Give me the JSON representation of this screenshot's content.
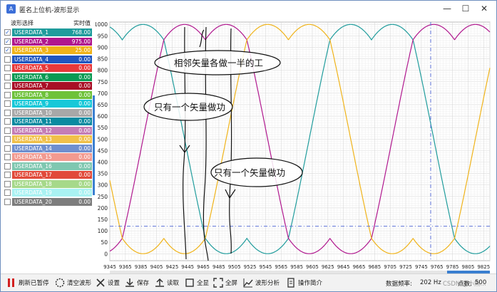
{
  "window": {
    "title": "匿名上位机-波形显示",
    "minimize": "—",
    "maximize": "☐",
    "close": "✕"
  },
  "left_panel": {
    "header_select": "波形选择",
    "header_value": "实时值",
    "channels": [
      {
        "name": "USERDATA_1",
        "value": "768.00",
        "checked": true,
        "color": "#1f9c9c"
      },
      {
        "name": "USERDATA_2",
        "value": "975.00",
        "checked": true,
        "color": "#b0178e"
      },
      {
        "name": "USERDATA_3",
        "value": "25.00",
        "checked": true,
        "color": "#f0b319"
      },
      {
        "name": "USERDATA_4",
        "value": "0.00",
        "checked": false,
        "color": "#1f56c0"
      },
      {
        "name": "USERDATA_5",
        "value": "0.00",
        "checked": false,
        "color": "#e8393b"
      },
      {
        "name": "USERDATA_6",
        "value": "0.00",
        "checked": false,
        "color": "#0a9a53"
      },
      {
        "name": "USERDATA_7",
        "value": "0.00",
        "checked": false,
        "color": "#a80f26"
      },
      {
        "name": "USERDATA_8",
        "value": "0.00",
        "checked": false,
        "color": "#6ec23a"
      },
      {
        "name": "USERDATA_9",
        "value": "0.00",
        "checked": false,
        "color": "#17c8d8"
      },
      {
        "name": "USERDATA_10",
        "value": "0.00",
        "checked": false,
        "color": "#a8a8a8"
      },
      {
        "name": "USERDATA_11",
        "value": "0.00",
        "checked": false,
        "color": "#0a8aa0"
      },
      {
        "name": "USERDATA_12",
        "value": "0.00",
        "checked": false,
        "color": "#c47db6"
      },
      {
        "name": "USERDATA_13",
        "value": "0.00",
        "checked": false,
        "color": "#f1c04a"
      },
      {
        "name": "USERDATA_14",
        "value": "0.00",
        "checked": false,
        "color": "#6f8fcf"
      },
      {
        "name": "USERDATA_15",
        "value": "0.00",
        "checked": false,
        "color": "#f29a90"
      },
      {
        "name": "USERDATA_16",
        "value": "0.00",
        "checked": false,
        "color": "#7fc7b0"
      },
      {
        "name": "USERDATA_17",
        "value": "0.00",
        "checked": false,
        "color": "#e14a3a"
      },
      {
        "name": "USERDATA_18",
        "value": "0.00",
        "checked": false,
        "color": "#a6d98a"
      },
      {
        "name": "USERDATA_19",
        "value": "0.00",
        "checked": false,
        "color": "#a9f2f2"
      },
      {
        "name": "USERDATA_20",
        "value": "0.00",
        "checked": false,
        "color": "#7d7d7d"
      }
    ]
  },
  "annotations": {
    "a1": "相邻矢量各做一半的工",
    "a2": "只有一个矢量做功",
    "a3": "只有一个矢量做功"
  },
  "chart_data": {
    "type": "line",
    "y_ticks": [
      "1000",
      "950",
      "900",
      "850",
      "800",
      "750",
      "700",
      "650",
      "600",
      "550",
      "500",
      "450",
      "400",
      "350",
      "300",
      "250",
      "200",
      "150",
      "100",
      "50",
      "0"
    ],
    "x_ticks": [
      "9345",
      "9365",
      "9385",
      "9405",
      "9425",
      "9445",
      "9465",
      "9485",
      "9505",
      "9525",
      "9545",
      "9565",
      "9585",
      "9605",
      "9625",
      "9645",
      "9665",
      "9685",
      "9705",
      "9725",
      "9745",
      "9765",
      "9785",
      "9805",
      "9825"
    ],
    "xlim": [
      9345,
      9833
    ],
    "ylim": [
      -30,
      1010
    ],
    "grid": true,
    "cursor": {
      "x": 9757,
      "y": 120
    },
    "series": [
      {
        "name": "USERDATA_1",
        "color": "#1f9c9c",
        "phase_deg": 0
      },
      {
        "name": "USERDATA_2",
        "color": "#b0178e",
        "phase_deg": -120
      },
      {
        "name": "USERDATA_3",
        "color": "#f0b319",
        "phase_deg": 120
      }
    ],
    "period": 320,
    "x_at_phase_zero": 9361
  },
  "toolbar": {
    "pause": "刷新已暂停",
    "clear": "清空波形",
    "settings": "设置",
    "save": "保存",
    "read": "读取",
    "show_all": "全显",
    "fullscreen": "全屏",
    "analysis": "波形分析",
    "manual": "操作简介",
    "freq_label": "数据频率:",
    "freq_value": "202 Hz",
    "points_label": "点数:",
    "points_value": "500",
    "watermark": "CSDN @小熊..."
  }
}
